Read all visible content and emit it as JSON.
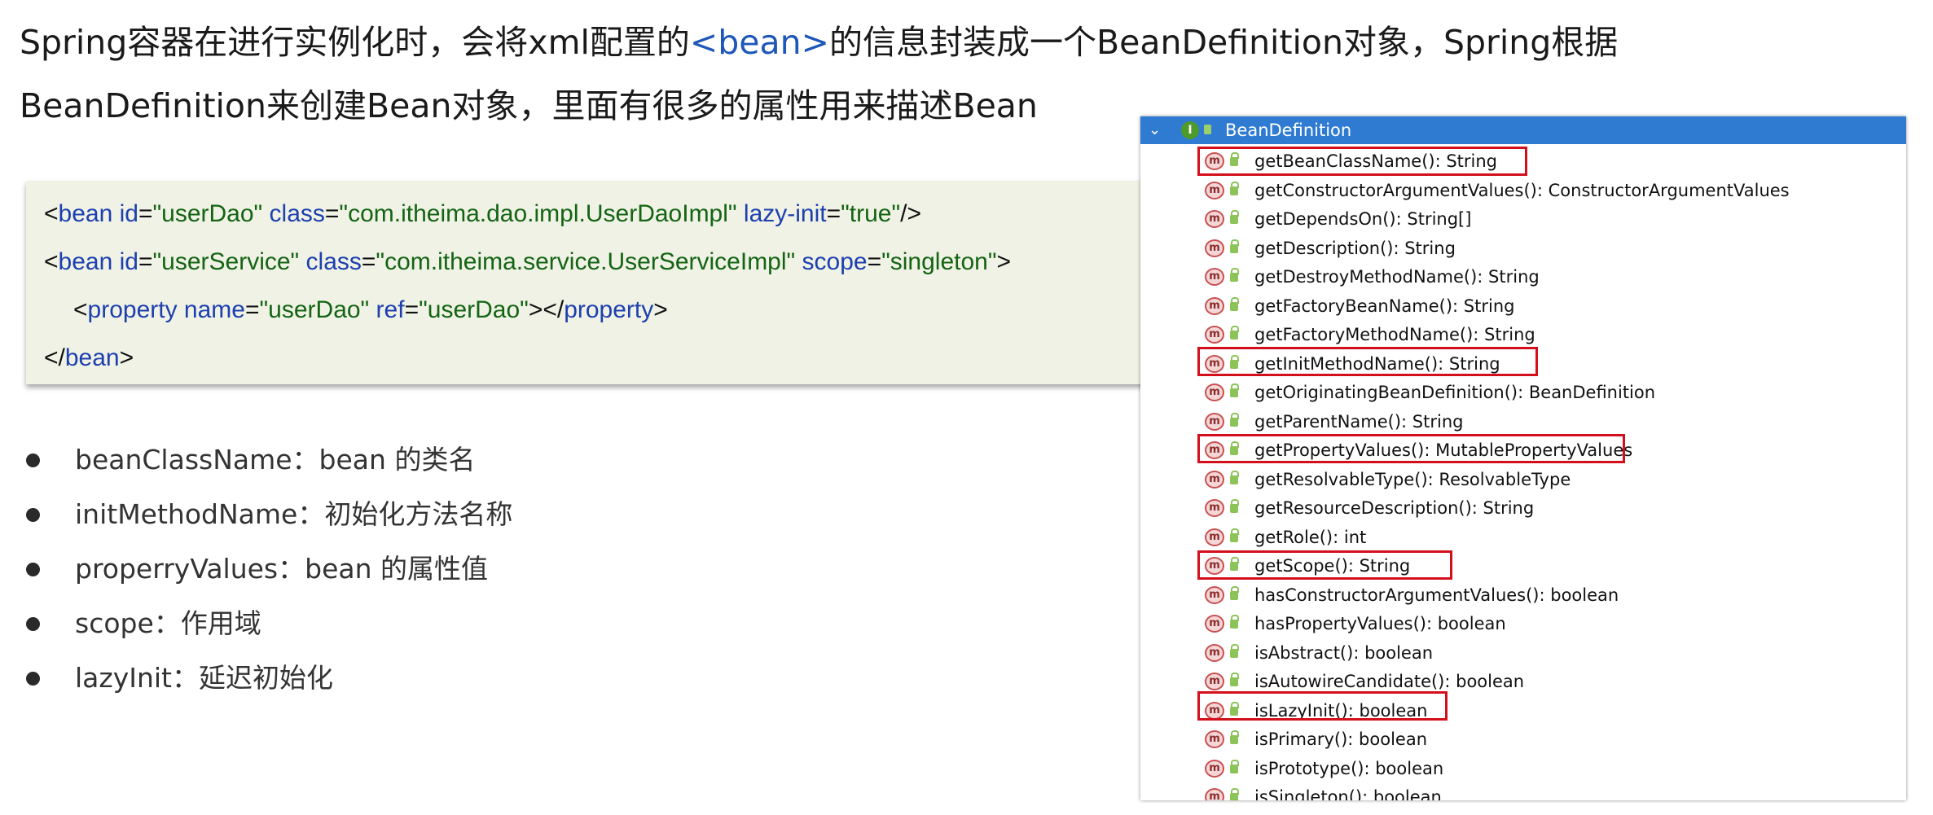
{
  "heading": {
    "line1_prefix": "Spring容器在进行实例化时，会将xml配置的",
    "line1_tag": "<bean>",
    "line1_suffix": "的信息封装成一个BeanDefinition对象，Spring根据",
    "line2": "BeanDefinition来创建Bean对象，里面有很多的属性用来描述Bean"
  },
  "code": {
    "line1": {
      "open": "<",
      "tag": "bean",
      "a1": " id",
      "eq1": "=",
      "v1": "\"userDao\"",
      "a2": " class",
      "eq2": "=",
      "v2": "\"com.itheima.dao.impl.UserDaoImpl\"",
      "a3": " lazy-init",
      "eq3": "=",
      "v3": "\"true\"",
      "close": "/>"
    },
    "line2": {
      "open": "<",
      "tag": "bean",
      "a1": " id",
      "eq1": "=",
      "v1": "\"userService\"",
      "a2": " class",
      "eq2": "=",
      "v2": "\"com.itheima.service.UserServiceImpl\"",
      "a3": " scope",
      "eq3": "=",
      "v3": "\"singleton\"",
      "close": ">"
    },
    "line3": {
      "open": "<",
      "tag": "property",
      "a1": " name",
      "eq1": "=",
      "v1": "\"userDao\"",
      "a2": " ref",
      "eq2": "=",
      "v2": "\"userDao\"",
      "mid": "></",
      "tag2": "property",
      "close": ">"
    },
    "line4": {
      "open": "</",
      "tag": "bean",
      "close": ">"
    }
  },
  "bullets": [
    "beanClassName：bean 的类名",
    "initMethodName：初始化方法名称",
    "properryValues：bean 的属性值",
    "scope：作用域",
    "lazyInit：延迟初始化"
  ],
  "tree": {
    "chevron": "⌄",
    "iface_icon": "I",
    "title": "BeanDefinition",
    "method_icon": "m",
    "methods": [
      "getBeanClassName(): String",
      "getConstructorArgumentValues(): ConstructorArgumentValues",
      "getDependsOn(): String[]",
      "getDescription(): String",
      "getDestroyMethodName(): String",
      "getFactoryBeanName(): String",
      "getFactoryMethodName(): String",
      "getInitMethodName(): String",
      "getOriginatingBeanDefinition(): BeanDefinition",
      "getParentName(): String",
      "getPropertyValues(): MutablePropertyValues",
      "getResolvableType(): ResolvableType",
      "getResourceDescription(): String",
      "getRole(): int",
      "getScope(): String",
      "hasConstructorArgumentValues(): boolean",
      "hasPropertyValues(): boolean",
      "isAbstract(): boolean",
      "isAutowireCandidate(): boolean",
      "isLazyInit(): boolean",
      "isPrimary(): boolean",
      "isPrototype(): boolean",
      "isSingleton(): boolean"
    ]
  },
  "colors": {
    "highlight": "#d40f1c",
    "tree_header": "#2f7bd1",
    "code_bg": "#eff2e4",
    "tag_blue": "#1d57b8"
  }
}
